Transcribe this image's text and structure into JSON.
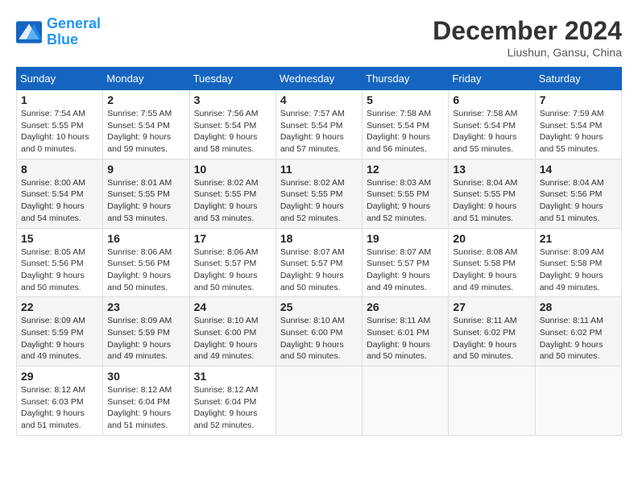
{
  "header": {
    "logo_line1": "General",
    "logo_line2": "Blue",
    "month_year": "December 2024",
    "location": "Liushun, Gansu, China"
  },
  "weekdays": [
    "Sunday",
    "Monday",
    "Tuesday",
    "Wednesday",
    "Thursday",
    "Friday",
    "Saturday"
  ],
  "weeks": [
    [
      {
        "day": "1",
        "sunrise": "Sunrise: 7:54 AM",
        "sunset": "Sunset: 5:55 PM",
        "daylight": "Daylight: 10 hours and 0 minutes."
      },
      {
        "day": "2",
        "sunrise": "Sunrise: 7:55 AM",
        "sunset": "Sunset: 5:54 PM",
        "daylight": "Daylight: 9 hours and 59 minutes."
      },
      {
        "day": "3",
        "sunrise": "Sunrise: 7:56 AM",
        "sunset": "Sunset: 5:54 PM",
        "daylight": "Daylight: 9 hours and 58 minutes."
      },
      {
        "day": "4",
        "sunrise": "Sunrise: 7:57 AM",
        "sunset": "Sunset: 5:54 PM",
        "daylight": "Daylight: 9 hours and 57 minutes."
      },
      {
        "day": "5",
        "sunrise": "Sunrise: 7:58 AM",
        "sunset": "Sunset: 5:54 PM",
        "daylight": "Daylight: 9 hours and 56 minutes."
      },
      {
        "day": "6",
        "sunrise": "Sunrise: 7:58 AM",
        "sunset": "Sunset: 5:54 PM",
        "daylight": "Daylight: 9 hours and 55 minutes."
      },
      {
        "day": "7",
        "sunrise": "Sunrise: 7:59 AM",
        "sunset": "Sunset: 5:54 PM",
        "daylight": "Daylight: 9 hours and 55 minutes."
      }
    ],
    [
      {
        "day": "8",
        "sunrise": "Sunrise: 8:00 AM",
        "sunset": "Sunset: 5:54 PM",
        "daylight": "Daylight: 9 hours and 54 minutes."
      },
      {
        "day": "9",
        "sunrise": "Sunrise: 8:01 AM",
        "sunset": "Sunset: 5:55 PM",
        "daylight": "Daylight: 9 hours and 53 minutes."
      },
      {
        "day": "10",
        "sunrise": "Sunrise: 8:02 AM",
        "sunset": "Sunset: 5:55 PM",
        "daylight": "Daylight: 9 hours and 53 minutes."
      },
      {
        "day": "11",
        "sunrise": "Sunrise: 8:02 AM",
        "sunset": "Sunset: 5:55 PM",
        "daylight": "Daylight: 9 hours and 52 minutes."
      },
      {
        "day": "12",
        "sunrise": "Sunrise: 8:03 AM",
        "sunset": "Sunset: 5:55 PM",
        "daylight": "Daylight: 9 hours and 52 minutes."
      },
      {
        "day": "13",
        "sunrise": "Sunrise: 8:04 AM",
        "sunset": "Sunset: 5:55 PM",
        "daylight": "Daylight: 9 hours and 51 minutes."
      },
      {
        "day": "14",
        "sunrise": "Sunrise: 8:04 AM",
        "sunset": "Sunset: 5:56 PM",
        "daylight": "Daylight: 9 hours and 51 minutes."
      }
    ],
    [
      {
        "day": "15",
        "sunrise": "Sunrise: 8:05 AM",
        "sunset": "Sunset: 5:56 PM",
        "daylight": "Daylight: 9 hours and 50 minutes."
      },
      {
        "day": "16",
        "sunrise": "Sunrise: 8:06 AM",
        "sunset": "Sunset: 5:56 PM",
        "daylight": "Daylight: 9 hours and 50 minutes."
      },
      {
        "day": "17",
        "sunrise": "Sunrise: 8:06 AM",
        "sunset": "Sunset: 5:57 PM",
        "daylight": "Daylight: 9 hours and 50 minutes."
      },
      {
        "day": "18",
        "sunrise": "Sunrise: 8:07 AM",
        "sunset": "Sunset: 5:57 PM",
        "daylight": "Daylight: 9 hours and 50 minutes."
      },
      {
        "day": "19",
        "sunrise": "Sunrise: 8:07 AM",
        "sunset": "Sunset: 5:57 PM",
        "daylight": "Daylight: 9 hours and 49 minutes."
      },
      {
        "day": "20",
        "sunrise": "Sunrise: 8:08 AM",
        "sunset": "Sunset: 5:58 PM",
        "daylight": "Daylight: 9 hours and 49 minutes."
      },
      {
        "day": "21",
        "sunrise": "Sunrise: 8:09 AM",
        "sunset": "Sunset: 5:58 PM",
        "daylight": "Daylight: 9 hours and 49 minutes."
      }
    ],
    [
      {
        "day": "22",
        "sunrise": "Sunrise: 8:09 AM",
        "sunset": "Sunset: 5:59 PM",
        "daylight": "Daylight: 9 hours and 49 minutes."
      },
      {
        "day": "23",
        "sunrise": "Sunrise: 8:09 AM",
        "sunset": "Sunset: 5:59 PM",
        "daylight": "Daylight: 9 hours and 49 minutes."
      },
      {
        "day": "24",
        "sunrise": "Sunrise: 8:10 AM",
        "sunset": "Sunset: 6:00 PM",
        "daylight": "Daylight: 9 hours and 49 minutes."
      },
      {
        "day": "25",
        "sunrise": "Sunrise: 8:10 AM",
        "sunset": "Sunset: 6:00 PM",
        "daylight": "Daylight: 9 hours and 50 minutes."
      },
      {
        "day": "26",
        "sunrise": "Sunrise: 8:11 AM",
        "sunset": "Sunset: 6:01 PM",
        "daylight": "Daylight: 9 hours and 50 minutes."
      },
      {
        "day": "27",
        "sunrise": "Sunrise: 8:11 AM",
        "sunset": "Sunset: 6:02 PM",
        "daylight": "Daylight: 9 hours and 50 minutes."
      },
      {
        "day": "28",
        "sunrise": "Sunrise: 8:11 AM",
        "sunset": "Sunset: 6:02 PM",
        "daylight": "Daylight: 9 hours and 50 minutes."
      }
    ],
    [
      {
        "day": "29",
        "sunrise": "Sunrise: 8:12 AM",
        "sunset": "Sunset: 6:03 PM",
        "daylight": "Daylight: 9 hours and 51 minutes."
      },
      {
        "day": "30",
        "sunrise": "Sunrise: 8:12 AM",
        "sunset": "Sunset: 6:04 PM",
        "daylight": "Daylight: 9 hours and 51 minutes."
      },
      {
        "day": "31",
        "sunrise": "Sunrise: 8:12 AM",
        "sunset": "Sunset: 6:04 PM",
        "daylight": "Daylight: 9 hours and 52 minutes."
      },
      null,
      null,
      null,
      null
    ]
  ]
}
